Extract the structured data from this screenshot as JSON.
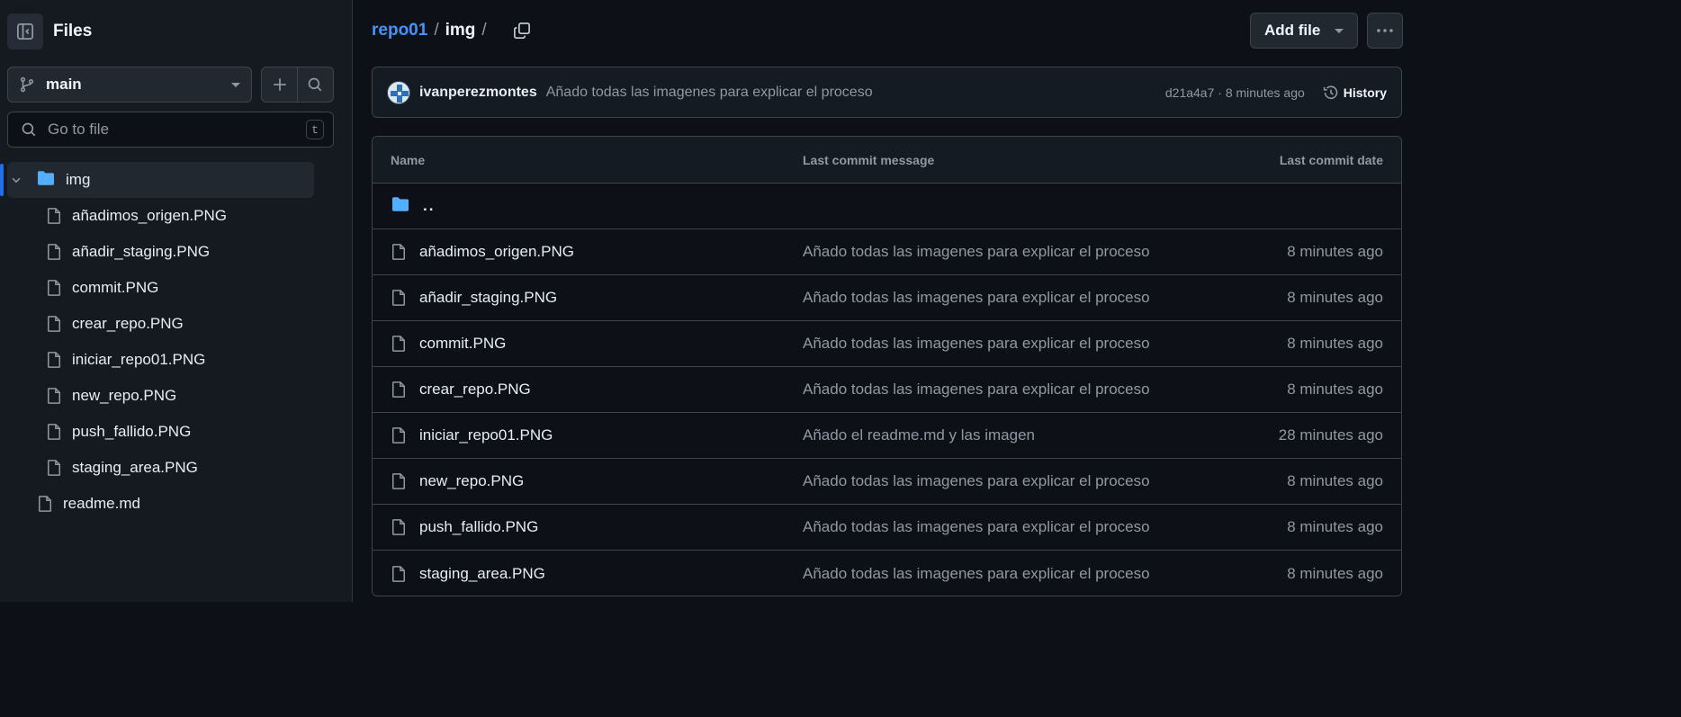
{
  "sidebar": {
    "title": "Files",
    "branch": "main",
    "search_placeholder": "Go to file",
    "search_shortcut": "t",
    "folder": {
      "name": "img",
      "expanded": true
    },
    "children": [
      "añadimos_origen.PNG",
      "añadir_staging.PNG",
      "commit.PNG",
      "crear_repo.PNG",
      "iniciar_repo01.PNG",
      "new_repo.PNG",
      "push_fallido.PNG",
      "staging_area.PNG"
    ],
    "root_files": [
      "readme.md"
    ]
  },
  "breadcrumb": {
    "repo": "repo01",
    "folder": "img",
    "sep": "/"
  },
  "toolbar": {
    "add_file_label": "Add file"
  },
  "latest_commit": {
    "author": "ivanperezmontes",
    "message": "Añado todas las imagenes para explicar el proceso",
    "meta": "d21a4a7 · 8 minutes ago",
    "history_label": "History"
  },
  "table": {
    "headers": {
      "name": "Name",
      "message": "Last commit message",
      "date": "Last commit date"
    },
    "parent_label": "..",
    "rows": [
      {
        "name": "añadimos_origen.PNG",
        "message": "Añado todas las imagenes para explicar el proceso",
        "date": "8 minutes ago"
      },
      {
        "name": "añadir_staging.PNG",
        "message": "Añado todas las imagenes para explicar el proceso",
        "date": "8 minutes ago"
      },
      {
        "name": "commit.PNG",
        "message": "Añado todas las imagenes para explicar el proceso",
        "date": "8 minutes ago"
      },
      {
        "name": "crear_repo.PNG",
        "message": "Añado todas las imagenes para explicar el proceso",
        "date": "8 minutes ago"
      },
      {
        "name": "iniciar_repo01.PNG",
        "message": "Añado el readme.md y las imagen",
        "date": "28 minutes ago"
      },
      {
        "name": "new_repo.PNG",
        "message": "Añado todas las imagenes para explicar el proceso",
        "date": "8 minutes ago"
      },
      {
        "name": "push_fallido.PNG",
        "message": "Añado todas las imagenes para explicar el proceso",
        "date": "8 minutes ago"
      },
      {
        "name": "staging_area.PNG",
        "message": "Añado todas las imagenes para explicar el proceso",
        "date": "8 minutes ago"
      }
    ]
  },
  "colors": {
    "accent": "#4493f8",
    "folder": "#54aeff",
    "bg": "#0d1117",
    "sidebar_bg": "#151a21"
  }
}
